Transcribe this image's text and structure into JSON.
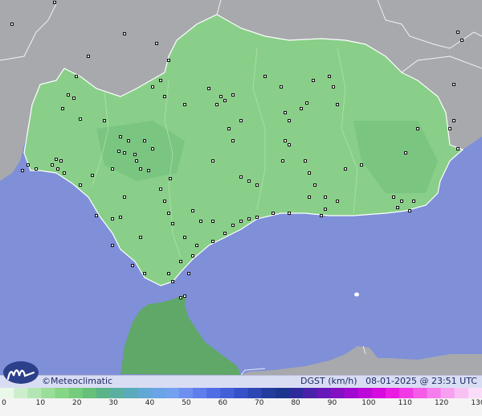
{
  "map": {
    "colors": {
      "sea": "#7f8fd8",
      "land_outside": "#a7a9ad",
      "land_region": "#89cf89",
      "land_region_dark": "#6ebd78",
      "morocco": "#5fa868",
      "station": "#111111"
    }
  },
  "header_bar": {
    "brand": "Meteoclimatic",
    "copyright_symbol": "©",
    "variable": "DGST (km/h)",
    "datetime": "08-01-2025 @ 23:51 UTC"
  },
  "scale": {
    "ticks": [
      "0",
      "10",
      "20",
      "30",
      "40",
      "50",
      "60",
      "70",
      "80",
      "90",
      "100",
      "110",
      "120",
      "130"
    ],
    "colors": [
      "#eaf8ea",
      "#cdeecd",
      "#b3e6b3",
      "#9ade9a",
      "#86d686",
      "#74cc7c",
      "#66c07a",
      "#5bb487",
      "#5ab0a0",
      "#5aacbc",
      "#62a8d4",
      "#6aa4e6",
      "#74a0f0",
      "#6e8ef0",
      "#5f7eec",
      "#506ee4",
      "#4360d8",
      "#3752c8",
      "#2c46b4",
      "#223c9e",
      "#1c3690",
      "#2e2a9c",
      "#4a22aa",
      "#6618b8",
      "#8410c4",
      "#a00ad0",
      "#bc08d8",
      "#d60ade",
      "#ea1ce2",
      "#f03ae6",
      "#f45ce8",
      "#f67eec",
      "#f8a0f0",
      "#f9c0f4",
      "#fbdcf8"
    ]
  }
}
